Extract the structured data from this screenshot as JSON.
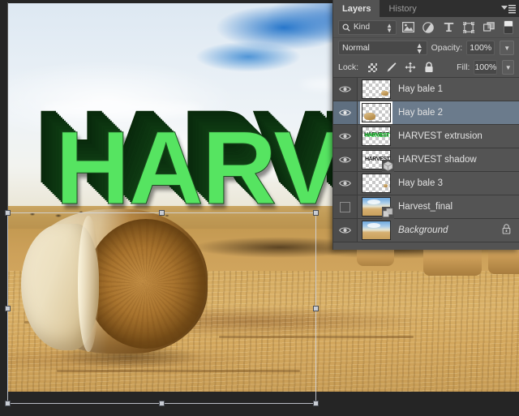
{
  "panel": {
    "tabs": [
      {
        "label": "Layers",
        "active": true
      },
      {
        "label": "History",
        "active": false
      }
    ],
    "menu_icon": "panel-menu-icon",
    "filter": {
      "kind_label": "Kind",
      "search_icon": "search-icon",
      "icons": [
        "pixel-layer-filter-icon",
        "adjustment-layer-filter-icon",
        "type-layer-filter-icon",
        "shape-layer-filter-icon",
        "smart-object-filter-icon"
      ],
      "toggle_name": "filter-enable-toggle"
    },
    "blend": {
      "mode": "Normal",
      "opacity_label": "Opacity:",
      "opacity_value": "100%"
    },
    "lock": {
      "label": "Lock:",
      "icons": [
        "lock-transparent-pixels-icon",
        "lock-image-pixels-icon",
        "lock-position-icon",
        "lock-all-icon"
      ],
      "fill_label": "Fill:",
      "fill_value": "100%"
    },
    "layers": [
      {
        "name": "Hay bale 1",
        "visible": true,
        "selected": false,
        "locked": false,
        "italic": false,
        "thumb": "transparent-bale-small-right"
      },
      {
        "name": "Hay bale 2",
        "visible": true,
        "selected": true,
        "locked": false,
        "italic": false,
        "thumb": "transparent-bale-left"
      },
      {
        "name": "HARVEST extrusion",
        "visible": true,
        "selected": false,
        "locked": false,
        "italic": false,
        "thumb": "transparent-green-harvest-text"
      },
      {
        "name": "HARVEST shadow",
        "visible": true,
        "selected": false,
        "locked": false,
        "italic": false,
        "thumb": "transparent-dark-harvest-text",
        "badge": "3d-layer-badge"
      },
      {
        "name": "Hay bale 3",
        "visible": true,
        "selected": false,
        "locked": false,
        "italic": false,
        "thumb": "transparent-bale-tiny-right"
      },
      {
        "name": "Harvest_final",
        "visible": false,
        "selected": false,
        "locked": false,
        "italic": false,
        "thumb": "field-photo",
        "badge": "smart-object-badge"
      },
      {
        "name": "Background",
        "visible": true,
        "selected": false,
        "locked": true,
        "italic": true,
        "thumb": "field-photo"
      }
    ]
  },
  "canvas": {
    "headline_text": "HARVEST",
    "text_color": "#56e461",
    "extrusion_color": "#0c3410",
    "transform_handles": [
      "top-left-handle",
      "top-center-handle",
      "top-right-handle",
      "middle-left-handle",
      "middle-right-handle",
      "bottom-left-handle",
      "bottom-center-handle",
      "bottom-right-handle"
    ]
  },
  "colors": {
    "panel_bg": "#535353",
    "panel_tabbar": "#2f2f2f",
    "row_bg": "#545454",
    "row_selected": "#6b7b8c",
    "app_bg": "#252525"
  }
}
